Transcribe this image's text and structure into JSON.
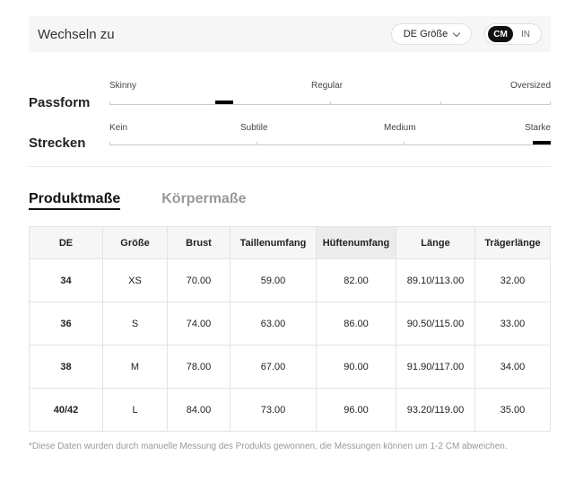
{
  "header": {
    "title": "Wechseln zu",
    "size_system": "DE Größe",
    "units": [
      {
        "label": "CM",
        "active": true
      },
      {
        "label": "IN",
        "active": false
      }
    ]
  },
  "fit": {
    "passform": {
      "name": "Passform",
      "labels": [
        "Skinny",
        "Regular",
        "Oversized"
      ],
      "marker_fraction": 0.25
    },
    "strecken": {
      "name": "Strecken",
      "labels": [
        "Kein",
        "Subtile",
        "Medium",
        "Starke"
      ],
      "marker_fraction": 1.0
    }
  },
  "tabs": [
    {
      "label": "Produktmaße",
      "active": true
    },
    {
      "label": "Körpermaße",
      "active": false
    }
  ],
  "table": {
    "columns": [
      "DE",
      "Größe",
      "Brust",
      "Taillenumfang",
      "Hüftenumfang",
      "Länge",
      "Trägerlänge"
    ],
    "highlight_column": 4,
    "rows": [
      [
        "34",
        "XS",
        "70.00",
        "59.00",
        "82.00",
        "89.10/113.00",
        "32.00"
      ],
      [
        "36",
        "S",
        "74.00",
        "63.00",
        "86.00",
        "90.50/115.00",
        "33.00"
      ],
      [
        "38",
        "M",
        "78.00",
        "67.00",
        "90.00",
        "91.90/117.00",
        "34.00"
      ],
      [
        "40/42",
        "L",
        "84.00",
        "73.00",
        "96.00",
        "93.20/119.00",
        "35.00"
      ]
    ]
  },
  "footnote": "*Diese Daten wurden durch manuelle Messung des Produkts gewonnen, die Messungen können um 1-2 CM abweichen."
}
